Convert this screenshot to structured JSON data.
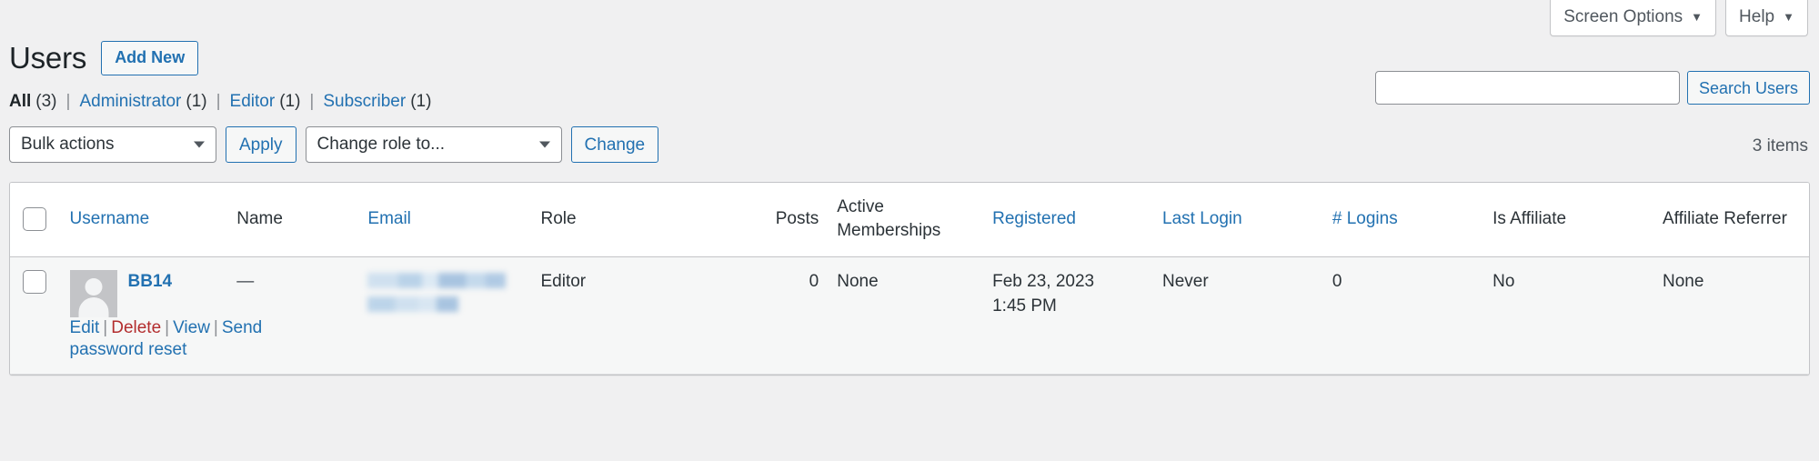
{
  "meta_tabs": [
    {
      "label": "Screen Options",
      "icon": "chevron-down-icon"
    },
    {
      "label": "Help",
      "icon": "chevron-down-icon"
    }
  ],
  "header": {
    "title": "Users",
    "add_new_label": "Add New"
  },
  "filters": [
    {
      "label": "All",
      "count": "(3)",
      "current": true
    },
    {
      "label": "Administrator",
      "count": "(1)",
      "current": false
    },
    {
      "label": "Editor",
      "count": "(1)",
      "current": false
    },
    {
      "label": "Subscriber",
      "count": "(1)",
      "current": false
    }
  ],
  "filter_separator": "|",
  "search": {
    "value": "",
    "placeholder": "",
    "button_label": "Search Users"
  },
  "tablenav": {
    "bulk_actions_selected": "Bulk actions",
    "apply_label": "Apply",
    "change_role_selected": "Change role to...",
    "change_label": "Change",
    "displaying_num": "3 items"
  },
  "table": {
    "columns": [
      {
        "label": "Username",
        "sortable": true
      },
      {
        "label": "Name",
        "sortable": false
      },
      {
        "label": "Email",
        "sortable": true
      },
      {
        "label": "Role",
        "sortable": false
      },
      {
        "label": "Posts",
        "sortable": false
      },
      {
        "label": "Active Memberships",
        "sortable": false
      },
      {
        "label": "Registered",
        "sortable": true
      },
      {
        "label": "Last Login",
        "sortable": true
      },
      {
        "label": "# Logins",
        "sortable": true
      },
      {
        "label": "Is Affiliate",
        "sortable": false
      },
      {
        "label": "Affiliate Referrer",
        "sortable": false
      }
    ],
    "rows": [
      {
        "username": "BB14",
        "avatar": "default-avatar-icon",
        "actions": [
          {
            "label": "Edit",
            "style": "link"
          },
          {
            "label": "Delete",
            "style": "delete"
          },
          {
            "label": "View",
            "style": "link"
          },
          {
            "label": "Send password reset",
            "style": "link"
          }
        ],
        "name": "—",
        "email": "",
        "email_redacted": true,
        "role": "Editor",
        "posts": "0",
        "memberships": "None",
        "registered_date": "Feb 23, 2023",
        "registered_time": "1:45 PM",
        "last_login": "Never",
        "logins": "0",
        "is_affiliate": "No",
        "affiliate_referrer": "None"
      }
    ]
  },
  "colors": {
    "link": "#2271b1",
    "delete": "#b32d2e",
    "page_bg": "#f0f0f1",
    "row_bg": "#f6f7f7",
    "border": "#c3c4c7",
    "redaction": "#a8c4e0"
  }
}
